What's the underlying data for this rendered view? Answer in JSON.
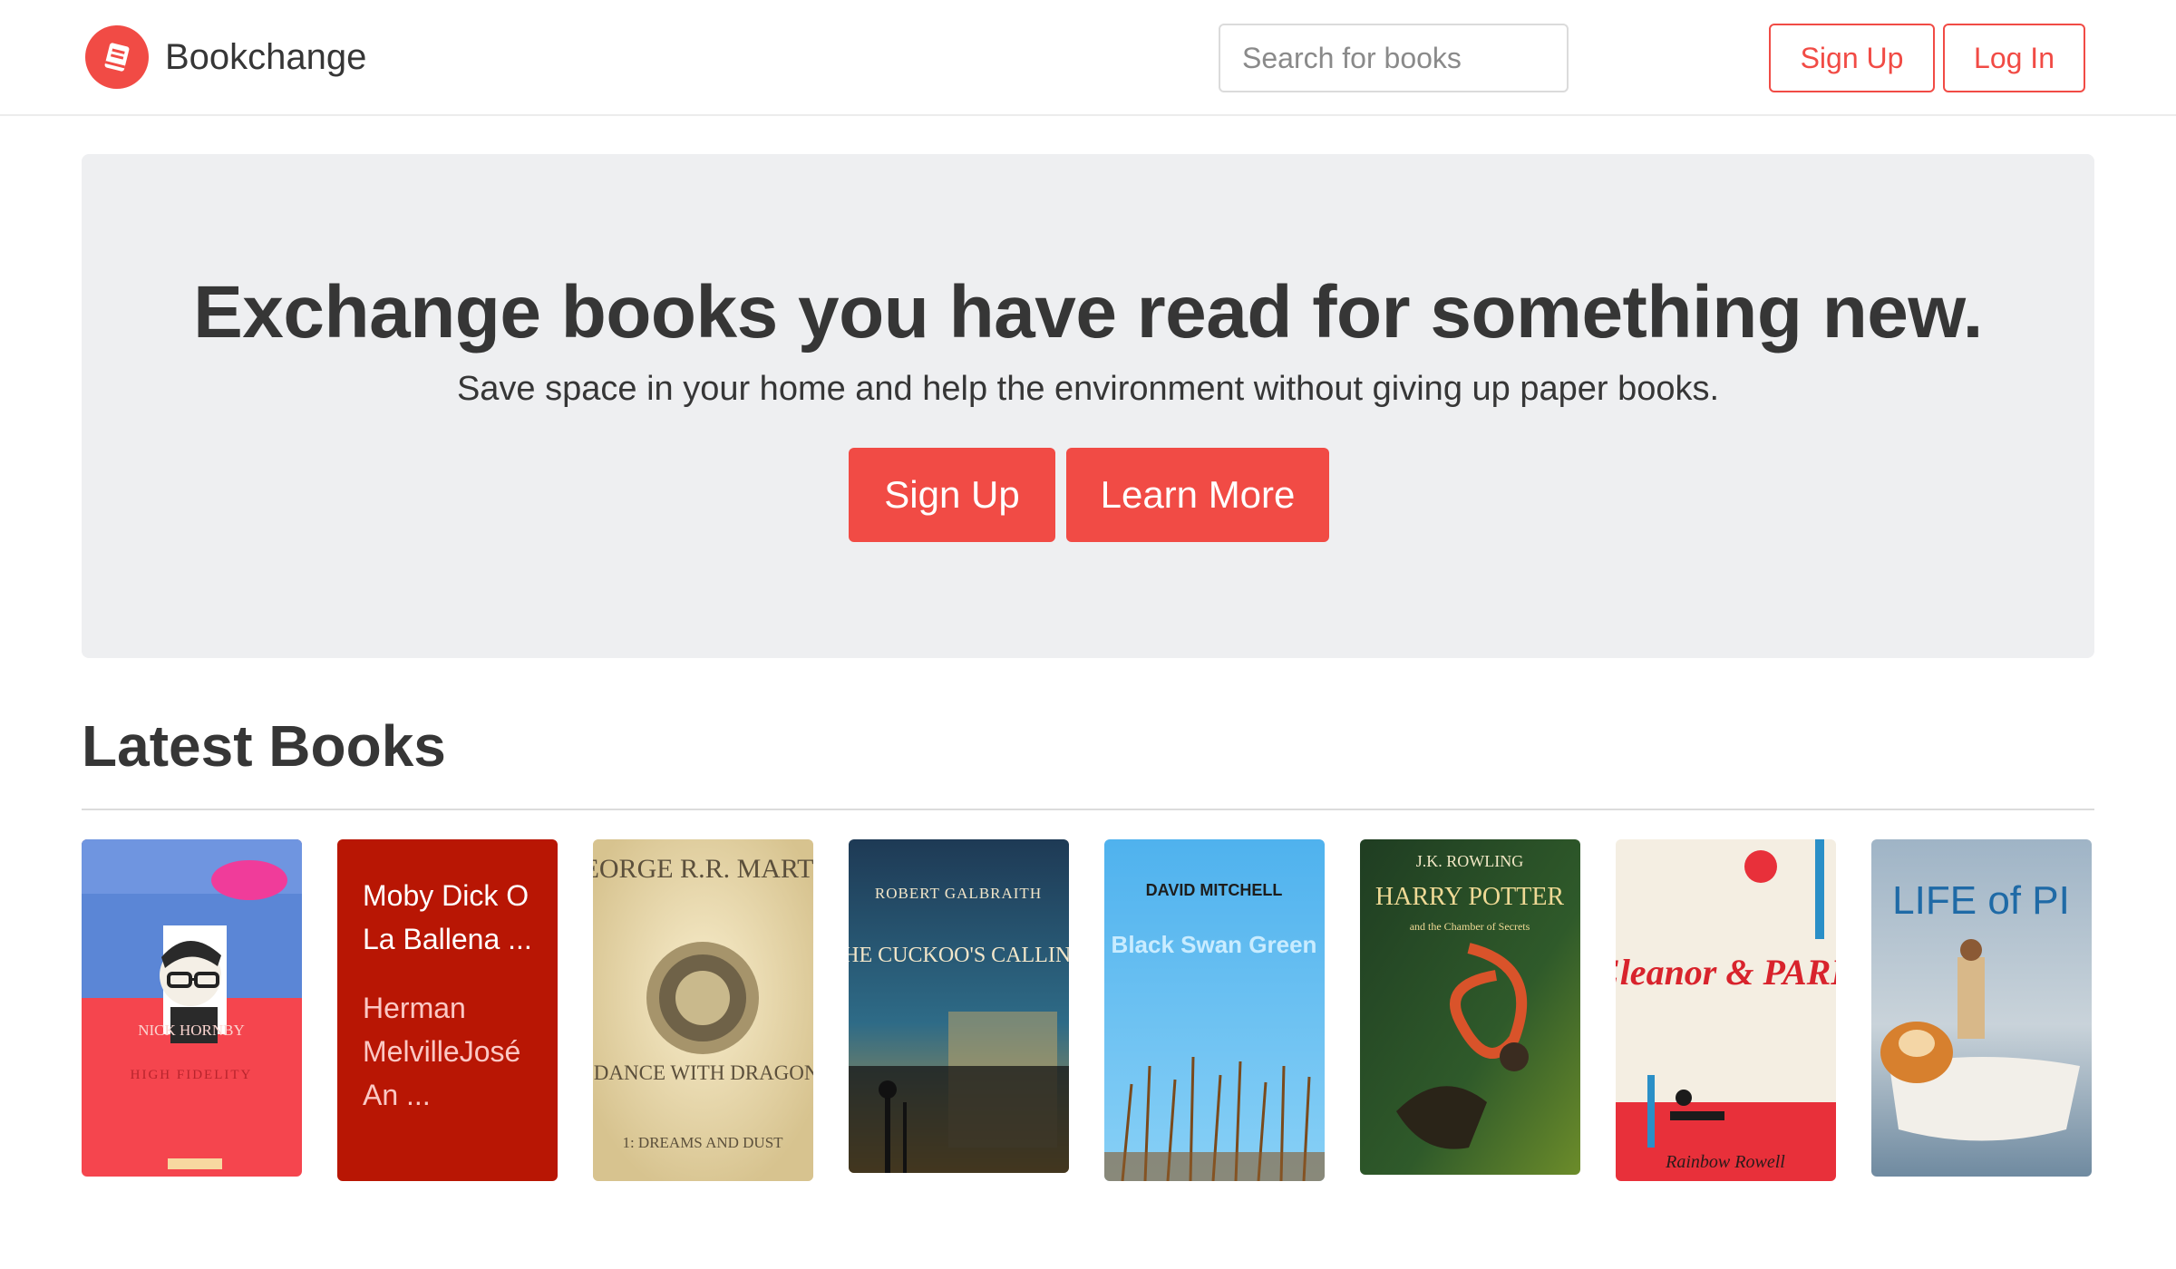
{
  "brand": {
    "name": "Bookchange",
    "logo_icon": "book-icon",
    "color": "#f14b45"
  },
  "search": {
    "placeholder": "Search for books",
    "value": ""
  },
  "nav": {
    "signup_label": "Sign Up",
    "login_label": "Log In"
  },
  "hero": {
    "title": "Exchange books you have read for something new.",
    "subtitle": "Save space in your home and help the environment without giving up paper books.",
    "signup_label": "Sign Up",
    "learn_more_label": "Learn More"
  },
  "latest": {
    "heading": "Latest Books",
    "books": [
      {
        "cover": {
          "author": "NICK HORNBY",
          "title": "HIGH FIDELITY"
        }
      },
      {
        "card": {
          "title": "Moby Dick O La Ballena ...",
          "author": "Herman MelvilleJosé An ..."
        }
      },
      {
        "cover": {
          "author": "GEORGE R.R. MARTIN",
          "title": "A DANCE WITH DRAGONS",
          "subtitle": "1: DREAMS AND DUST"
        }
      },
      {
        "cover": {
          "author": "ROBERT GALBRAITH",
          "title": "THE CUCKOO'S CALLING"
        }
      },
      {
        "cover": {
          "author": "DAVID MITCHELL",
          "title": "Black Swan Green"
        }
      },
      {
        "cover": {
          "author": "J.K. ROWLING",
          "title": "HARRY POTTER",
          "subtitle": "and the Chamber of Secrets"
        }
      },
      {
        "cover": {
          "title": "Eleanor & PARK",
          "author": "Rainbow Rowell"
        }
      },
      {
        "cover": {
          "title": "LIFE of PI"
        }
      }
    ]
  },
  "colors": {
    "accent": "#f14b45",
    "hero_bg": "#eeeff1",
    "text": "#363636"
  }
}
